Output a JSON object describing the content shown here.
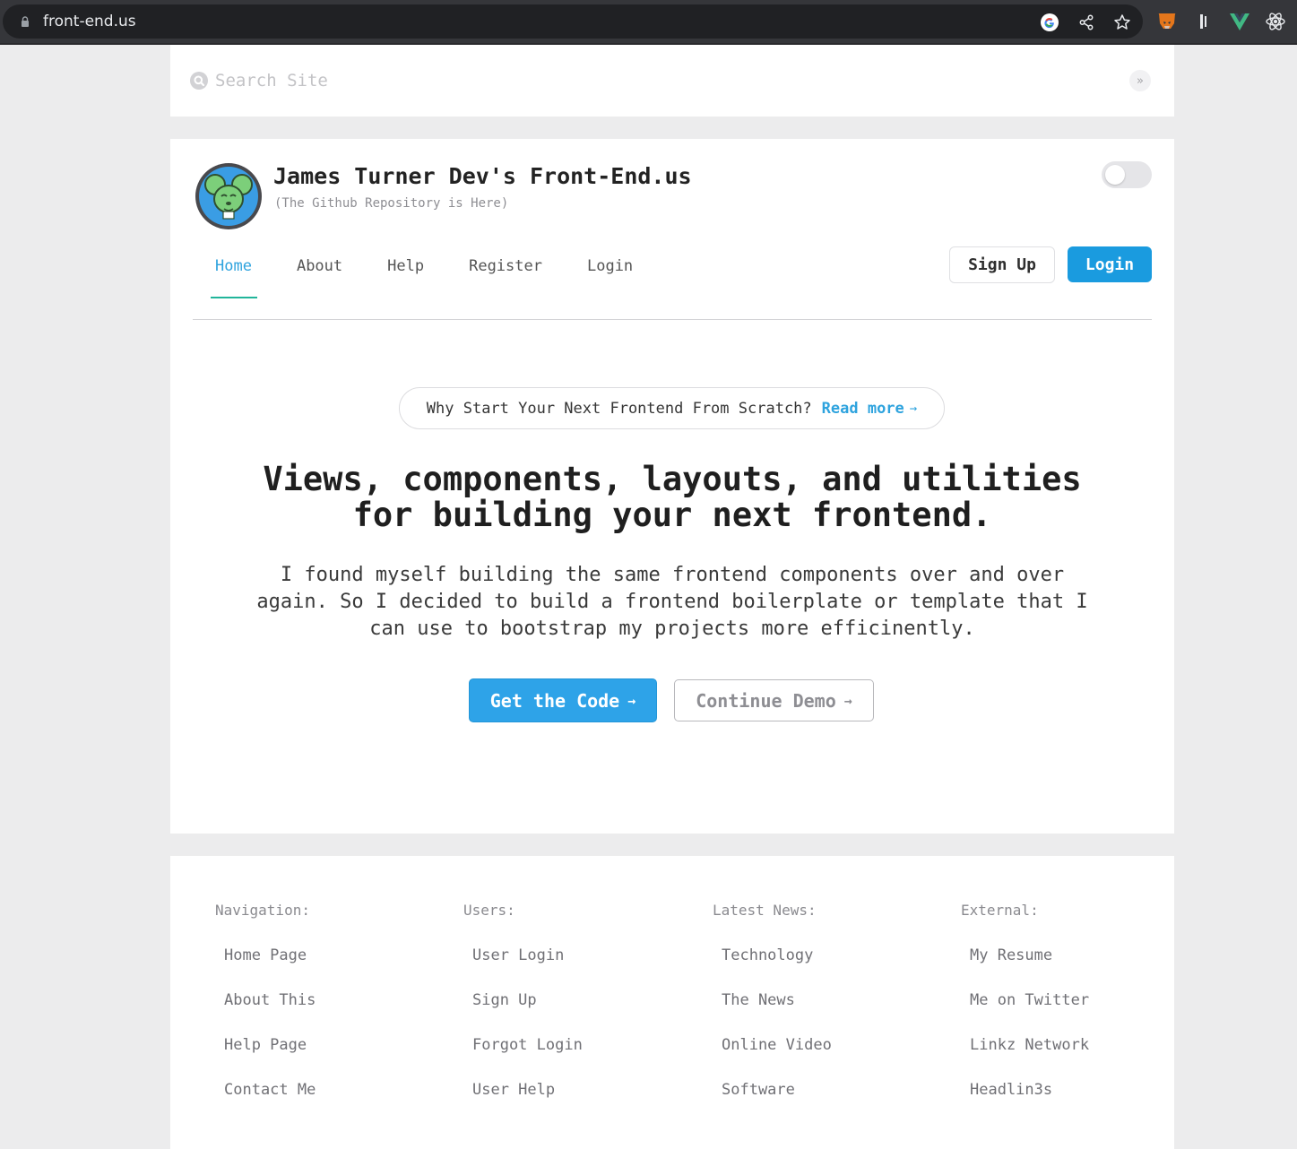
{
  "browser": {
    "url": "front-end.us"
  },
  "search": {
    "placeholder": "Search Site",
    "collapse_glyph": "»"
  },
  "header": {
    "title": "James Turner Dev's Front-End.us",
    "subtitle": "(The Github Repository is Here)"
  },
  "nav": {
    "items": [
      {
        "label": "Home",
        "active": true
      },
      {
        "label": "About",
        "active": false
      },
      {
        "label": "Help",
        "active": false
      },
      {
        "label": "Register",
        "active": false
      },
      {
        "label": "Login",
        "active": false
      }
    ],
    "signup_label": "Sign Up",
    "login_label": "Login"
  },
  "hero": {
    "pill_text": "Why Start Your Next Frontend From Scratch?",
    "pill_link": "Read more",
    "headline_line1": "Views, components, layouts, and utilities",
    "headline_line2": "for building your next frontend.",
    "lead": "I found myself building the same frontend components over and over again. So I decided to build a frontend boilerplate or template that I can use to bootstrap my projects more efficinently.",
    "primary_cta": "Get the Code",
    "secondary_cta": "Continue Demo"
  },
  "footer": {
    "columns": [
      {
        "heading": "Navigation:",
        "links": [
          "Home Page",
          "About This",
          "Help Page",
          "Contact Me"
        ]
      },
      {
        "heading": "Users:",
        "links": [
          "User Login",
          "Sign Up",
          "Forgot Login",
          "User Help"
        ]
      },
      {
        "heading": "Latest News:",
        "links": [
          "Technology",
          "The News",
          "Online Video",
          "Software"
        ]
      },
      {
        "heading": "External:",
        "links": [
          "My Resume",
          "Me on Twitter",
          "Linkz Network",
          "Headlin3s"
        ]
      }
    ]
  },
  "colors": {
    "accent": "#2ea3de",
    "primary_button": "#1a9bdf",
    "active_underline": "#21b59a",
    "page_background": "#ececed"
  },
  "icons": [
    "lock-icon",
    "google-icon",
    "share-icon",
    "star-icon",
    "metamask-extension-icon",
    "extension-icon",
    "vue-devtools-icon",
    "react-devtools-icon",
    "search-icon",
    "double-chevron-right-icon",
    "mouse-avatar",
    "arrow-right-icon"
  ]
}
